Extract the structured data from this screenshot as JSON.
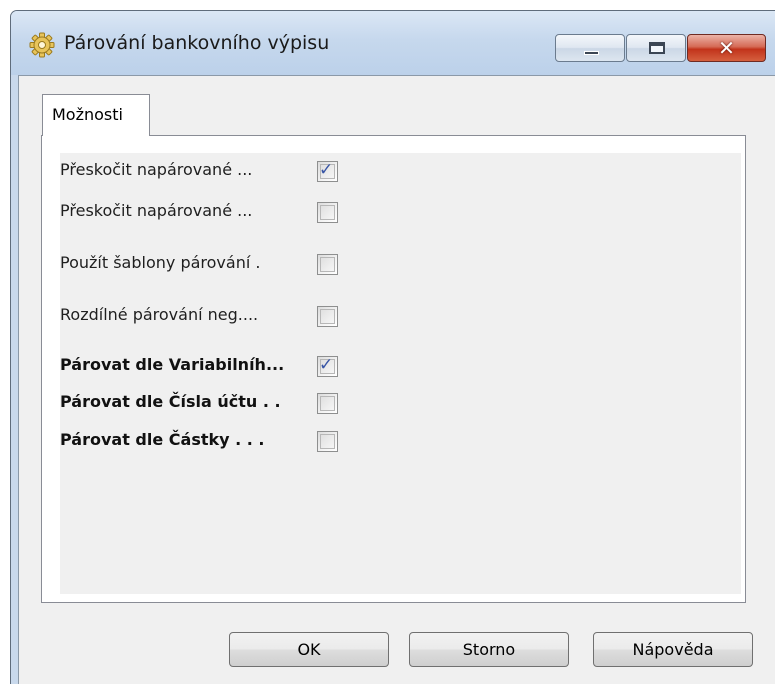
{
  "window": {
    "title": "Párování bankovního výpisu",
    "icon": "gear-icon"
  },
  "tabs": [
    {
      "label": "Možnosti",
      "selected": true
    }
  ],
  "options": [
    {
      "label": "Přeskočit napárované ...",
      "checked": true,
      "bold": false
    },
    {
      "label": "Přeskočit napárované ...",
      "checked": false,
      "bold": false
    },
    {
      "label": "Použít šablony párování .",
      "checked": false,
      "bold": false
    },
    {
      "label": "Rozdílné párování neg....",
      "checked": false,
      "bold": false
    },
    {
      "label": "Párovat dle Variabilníh...",
      "checked": true,
      "bold": true
    },
    {
      "label": "Párovat dle Čísla účtu . .",
      "checked": false,
      "bold": true
    },
    {
      "label": "Párovat dle Částky . . .",
      "checked": false,
      "bold": true
    }
  ],
  "buttons": {
    "ok": "OK",
    "cancel": "Storno",
    "help": "Nápověda"
  },
  "colors": {
    "checkmark": "#3855a5",
    "close_button": "#c2331b",
    "title_bar": "#c6d8ed"
  }
}
